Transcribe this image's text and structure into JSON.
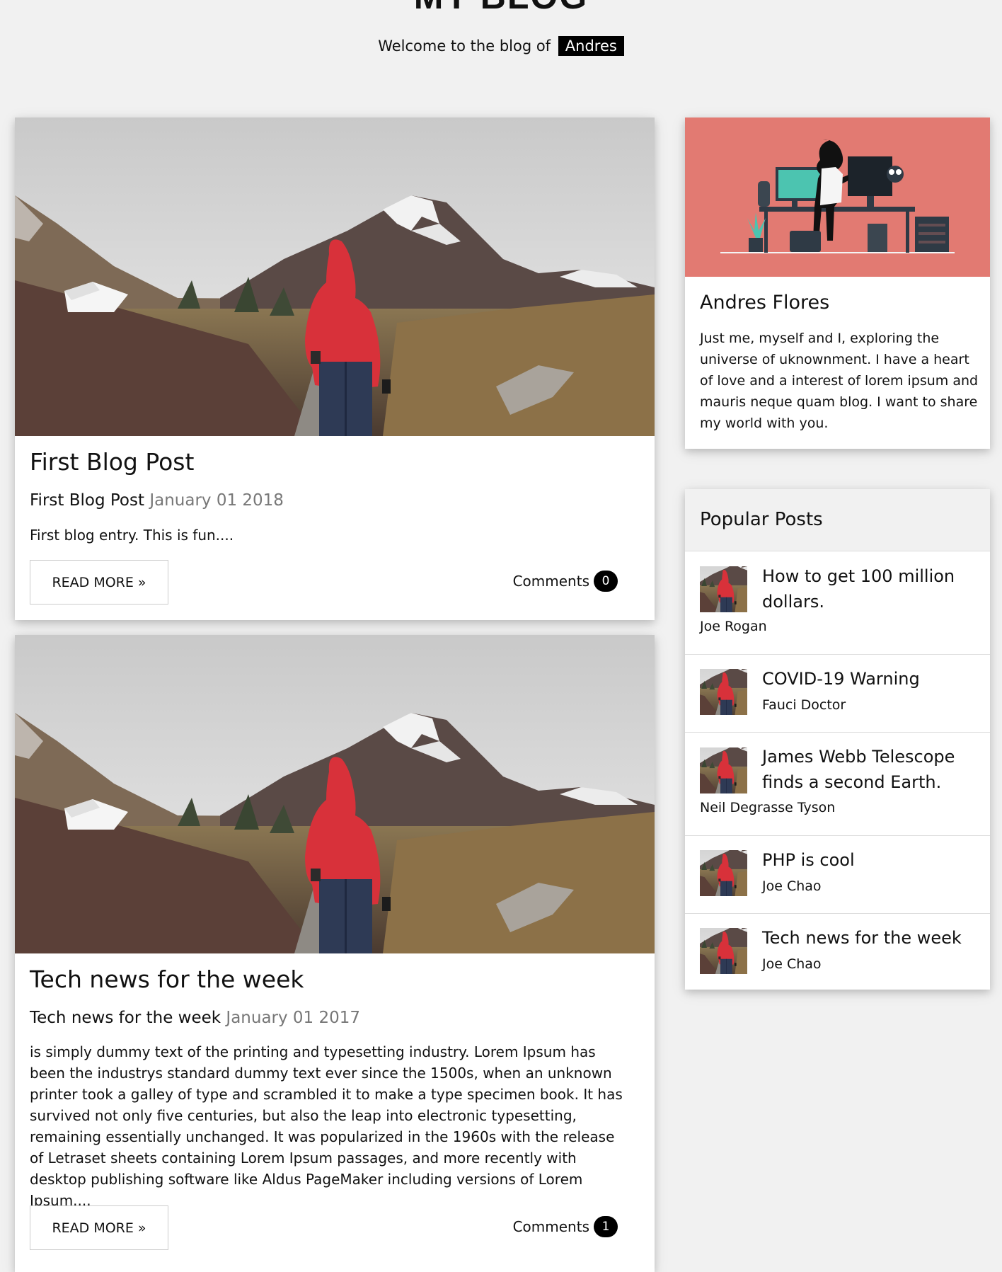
{
  "header": {
    "title": "MY BLOG",
    "welcome_text": "Welcome to the blog of",
    "owner_name": "Andres"
  },
  "posts": [
    {
      "heading": "First Blog Post",
      "subtitle": "First Blog Post",
      "date": "January 01 2018",
      "excerpt": "First blog entry. This is fun....",
      "read_more_label": "READ MORE »",
      "comments_label": "Comments",
      "comments_count": "0"
    },
    {
      "heading": "Tech news for the week",
      "subtitle": "Tech news for the week",
      "date": "January 01 2017",
      "excerpt": "is simply dummy text of the printing and typesetting industry. Lorem Ipsum has been the industrys standard dummy text ever since the 1500s, when an unknown printer took a galley of type and scrambled it to make a type specimen book. It has survived not only five centuries, but also the leap into electronic typesetting, remaining essentially unchanged. It was popularized in the 1960s with the release of Letraset sheets containing Lorem Ipsum passages, and more recently with desktop publishing software like Aldus PageMaker including versions of Lorem Ipsum....",
      "read_more_label": "READ MORE »",
      "comments_label": "Comments",
      "comments_count": "1"
    }
  ],
  "about": {
    "name": "Andres Flores",
    "bio": "Just me, myself and I, exploring the universe of uknownment. I have a heart of love and a interest of lorem ipsum and mauris neque quam blog. I want to share my world with you."
  },
  "popular": {
    "title": "Popular Posts",
    "items": [
      {
        "title": "How to get 100 million dollars.",
        "author": "Joe Rogan"
      },
      {
        "title": "COVID-19 Warning",
        "author": "Fauci Doctor"
      },
      {
        "title": "James Webb Telescope finds a second Earth.",
        "author": "Neil Degrasse Tyson"
      },
      {
        "title": "PHP is cool",
        "author": "Joe Chao"
      },
      {
        "title": "Tech news for the week",
        "author": "Joe Chao"
      }
    ]
  },
  "colors": {
    "page_background": "#f1f1f1",
    "about_image_background": "#e27a72",
    "badge_background": "#000000",
    "jacket_red": "#d8313a"
  }
}
